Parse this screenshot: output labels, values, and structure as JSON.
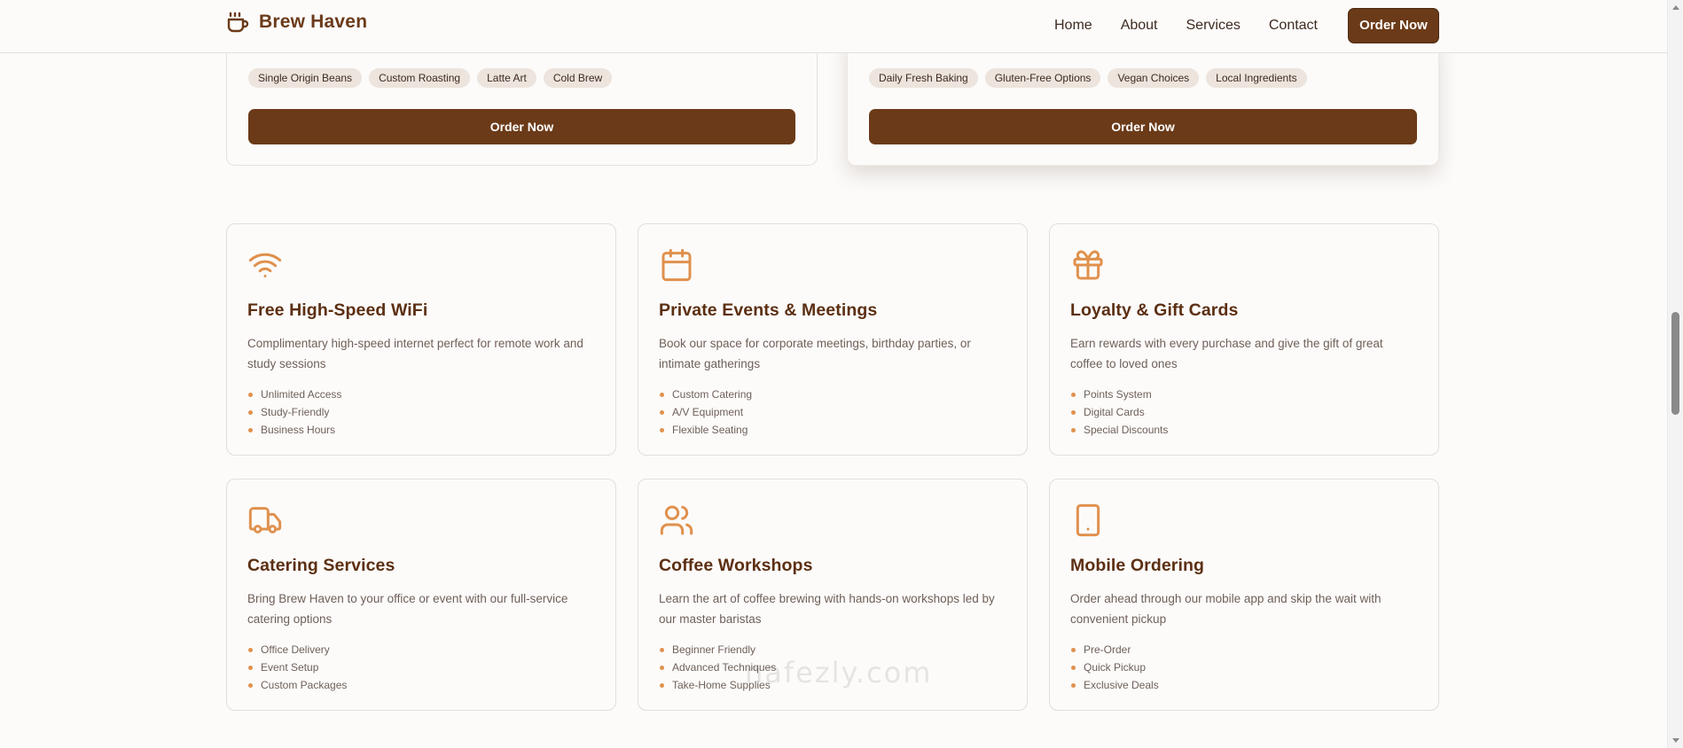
{
  "brand": {
    "name": "Brew Haven",
    "icon": "coffee-cup-icon"
  },
  "nav": {
    "links": [
      "Home",
      "About",
      "Services",
      "Contact"
    ],
    "cta": "Order Now"
  },
  "products": [
    {
      "tags": [
        "Single Origin Beans",
        "Custom Roasting",
        "Latte Art",
        "Cold Brew"
      ],
      "button": "Order Now"
    },
    {
      "tags": [
        "Daily Fresh Baking",
        "Gluten-Free Options",
        "Vegan Choices",
        "Local Ingredients"
      ],
      "button": "Order Now"
    }
  ],
  "services": [
    {
      "icon": "wifi-icon",
      "title": "Free High-Speed WiFi",
      "description": "Complimentary high-speed internet perfect for remote work and study sessions",
      "features": [
        "Unlimited Access",
        "Study-Friendly",
        "Business Hours"
      ]
    },
    {
      "icon": "calendar-icon",
      "title": "Private Events & Meetings",
      "description": "Book our space for corporate meetings, birthday parties, or intimate gatherings",
      "features": [
        "Custom Catering",
        "A/V Equipment",
        "Flexible Seating"
      ]
    },
    {
      "icon": "gift-icon",
      "title": "Loyalty & Gift Cards",
      "description": "Earn rewards with every purchase and give the gift of great coffee to loved ones",
      "features": [
        "Points System",
        "Digital Cards",
        "Special Discounts"
      ]
    },
    {
      "icon": "truck-icon",
      "title": "Catering Services",
      "description": "Bring Brew Haven to your office or event with our full-service catering options",
      "features": [
        "Office Delivery",
        "Event Setup",
        "Custom Packages"
      ]
    },
    {
      "icon": "users-icon",
      "title": "Coffee Workshops",
      "description": "Learn the art of coffee brewing with hands-on workshops led by our master baristas",
      "features": [
        "Beginner Friendly",
        "Advanced Techniques",
        "Take-Home Supplies"
      ]
    },
    {
      "icon": "smartphone-icon",
      "title": "Mobile Ordering",
      "description": "Order ahead through our mobile app and skip the wait with convenient pickup",
      "features": [
        "Pre-Order",
        "Quick Pickup",
        "Exclusive Deals"
      ]
    }
  ],
  "watermark": "nafezly.com",
  "colors": {
    "primary": "#6b3a18",
    "accent": "#e0914d",
    "heading": "#5c2f12",
    "background": "#fcfbfa"
  }
}
